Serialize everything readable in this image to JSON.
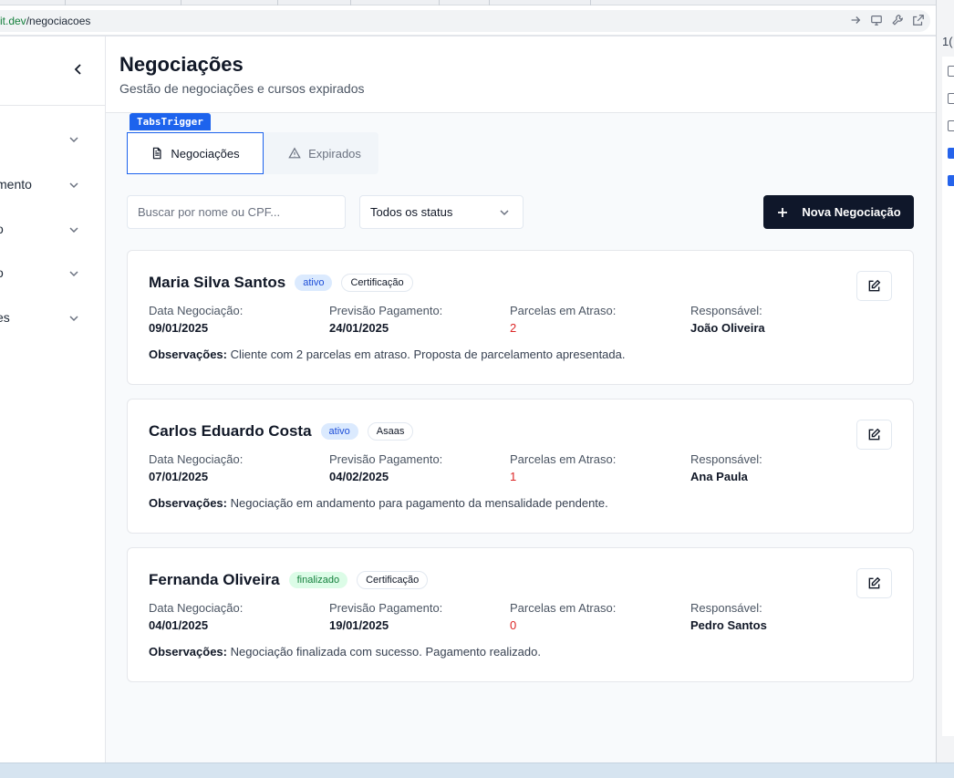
{
  "browser": {
    "url_host": "it.dev",
    "url_path": "/negociacoes"
  },
  "right_strip": {
    "top_text": "1("
  },
  "sidebar": {
    "items": [
      {
        "label": ""
      },
      {
        "label": "mento"
      },
      {
        "label": "o"
      },
      {
        "label": "o"
      },
      {
        "label": "es"
      }
    ]
  },
  "header": {
    "title": "Negociações",
    "subtitle": "Gestão de negociações e cursos expirados"
  },
  "dev_badge": "TabsTrigger",
  "tabs": [
    {
      "label": "Negociações",
      "icon": "file-text-icon",
      "active": true
    },
    {
      "label": "Expirados",
      "icon": "alert-triangle-icon",
      "active": false
    }
  ],
  "filters": {
    "search_placeholder": "Buscar por nome ou CPF...",
    "status_select": "Todos os status",
    "new_button": "Nova Negociação"
  },
  "labels": {
    "data": "Data Negociação:",
    "previsao": "Previsão Pagamento:",
    "parcelas": "Parcelas em Atraso:",
    "responsavel": "Responsável:",
    "obs": "Observações:"
  },
  "negociacoes": [
    {
      "name": "Maria Silva Santos",
      "status": "ativo",
      "tag": "Certificação",
      "data": "09/01/2025",
      "previsao": "24/01/2025",
      "parcelas": "2",
      "responsavel": "João Oliveira",
      "obs": "Cliente com 2 parcelas em atraso. Proposta de parcelamento apresentada."
    },
    {
      "name": "Carlos Eduardo Costa",
      "status": "ativo",
      "tag": "Asaas",
      "data": "07/01/2025",
      "previsao": "04/02/2025",
      "parcelas": "1",
      "responsavel": "Ana Paula",
      "obs": "Negociação em andamento para pagamento da mensalidade pendente."
    },
    {
      "name": "Fernanda Oliveira",
      "status": "finalizado",
      "tag": "Certificação",
      "data": "04/01/2025",
      "previsao": "19/01/2025",
      "parcelas": "0",
      "responsavel": "Pedro Santos",
      "obs": "Negociação finalizada com sucesso. Pagamento realizado."
    }
  ],
  "colors": {
    "primary_dark": "#0f172a",
    "accent_blue": "#1d63ed",
    "danger": "#dc2626",
    "success": "#15803d"
  }
}
